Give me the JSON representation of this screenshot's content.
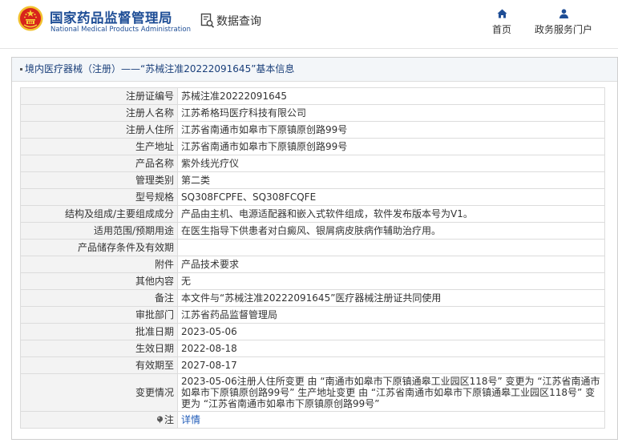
{
  "header": {
    "site_title": "国家药品监督管理局",
    "site_subtitle": "National Medical Products Administration",
    "query_label": "数据查询",
    "nav": {
      "home": "首页",
      "portal": "政务服务门户"
    }
  },
  "breadcrumb": "境内医疗器械（注册）——“苏械注准20222091645”基本信息",
  "rows": [
    {
      "label": "注册证编号",
      "value": "苏械注准20222091645"
    },
    {
      "label": "注册人名称",
      "value": "江苏希格玛医疗科技有限公司"
    },
    {
      "label": "注册人住所",
      "value": "江苏省南通市如皋市下原镇原创路99号"
    },
    {
      "label": "生产地址",
      "value": "江苏省南通市如皋市下原镇原创路99号"
    },
    {
      "label": "产品名称",
      "value": "紫外线光疗仪"
    },
    {
      "label": "管理类别",
      "value": "第二类"
    },
    {
      "label": "型号规格",
      "value": "SQ308FCPFE、SQ308FCQFE"
    },
    {
      "label": "结构及组成/主要组成成分",
      "value": "产品由主机、电源适配器和嵌入式软件组成，软件发布版本号为V1。"
    },
    {
      "label": "适用范围/预期用途",
      "value": "在医生指导下供患者对白癜风、银屑病皮肤病作辅助治疗用。"
    },
    {
      "label": "产品储存条件及有效期",
      "value": ""
    },
    {
      "label": "附件",
      "value": "产品技术要求"
    },
    {
      "label": "其他内容",
      "value": "无"
    },
    {
      "label": "备注",
      "value": "本文件与“苏械注准20222091645”医疗器械注册证共同使用"
    },
    {
      "label": "审批部门",
      "value": "江苏省药品监督管理局"
    },
    {
      "label": "批准日期",
      "value": "2023-05-06"
    },
    {
      "label": "生效日期",
      "value": "2022-08-18"
    },
    {
      "label": "有效期至",
      "value": "2027-08-17"
    },
    {
      "label": "变更情况",
      "value": "2023-05-06注册人住所变更 由 “南通市如皋市下原镇通皋工业园区118号” 变更为 “江苏省南通市如皋市下原镇原创路99号” 生产地址变更 由 “江苏省南通市如皋市下原镇通皋工业园区118号” 变更为 “江苏省南通市如皋市下原镇原创路99号”"
    }
  ],
  "note_row": {
    "label": "注",
    "link": "详情"
  }
}
